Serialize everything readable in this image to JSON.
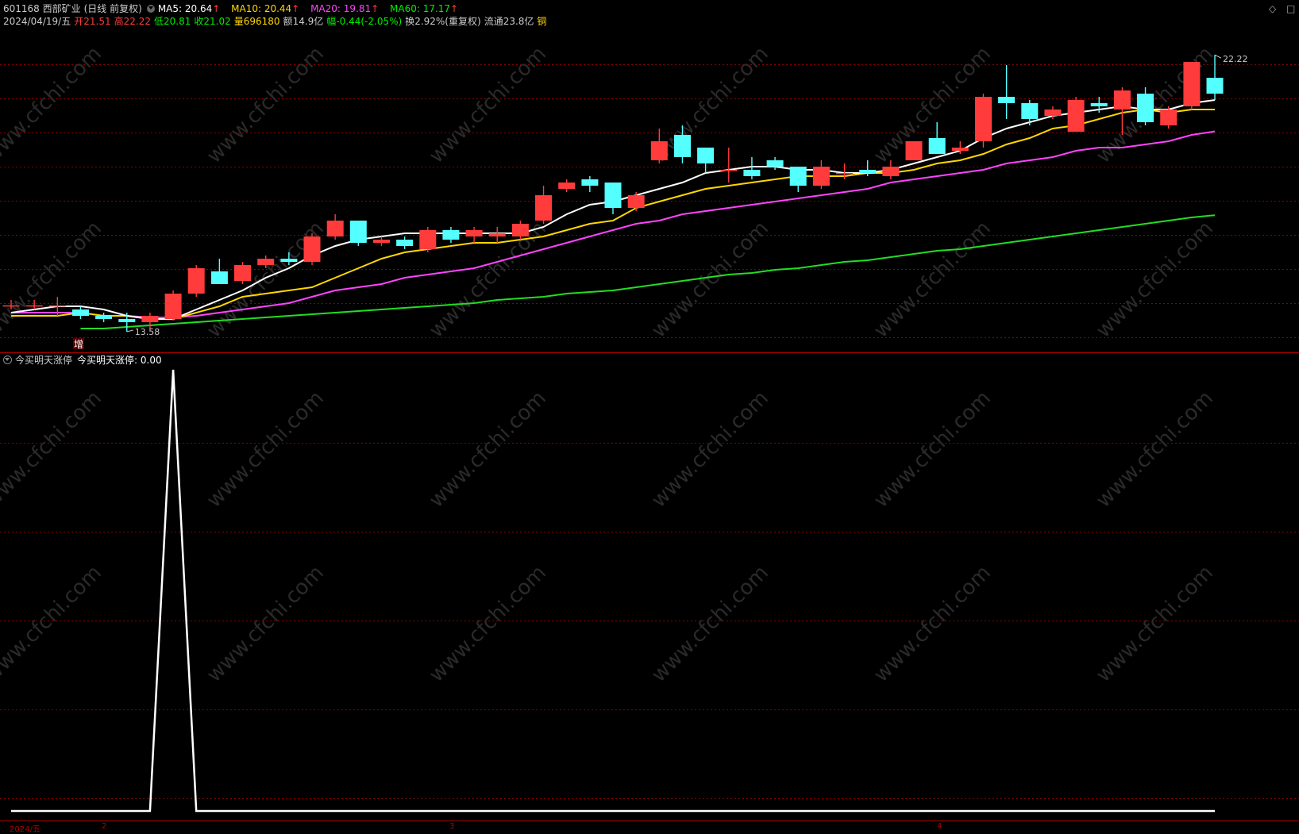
{
  "stock": {
    "code_name": "601168 西部矿业",
    "period": "(日线 前复权)",
    "date": "2024/04/19/五",
    "open_label": "开",
    "open": "21.51",
    "high_label": "高",
    "high": "22.22",
    "low_label": "低",
    "low": "20.81",
    "close_label": "收",
    "close": "21.02",
    "vol_label": "量",
    "vol": "696180",
    "amt_label": "额",
    "amt": "14.9亿",
    "chg_label": "幅",
    "chg": "-0.44(-2.05%)",
    "turnover": "换2.92%(重复权)",
    "float": "流通23.8亿",
    "sector": "铜"
  },
  "ma": [
    {
      "label": "MA5: 20.64",
      "arrow": "↑",
      "color": "#ffffff"
    },
    {
      "label": "MA10: 20.44",
      "arrow": "↑",
      "color": "#ffd700"
    },
    {
      "label": "MA20: 19.81",
      "arrow": "↑",
      "color": "#ff44ff"
    },
    {
      "label": "MA60: 17.17",
      "arrow": "↑",
      "color": "#00ee00"
    }
  ],
  "colors": {
    "up": "#ff3b3b",
    "down": "#54ffff",
    "ma5": "#ffffff",
    "ma10": "#ffd700",
    "ma20": "#ff44ff",
    "ma60": "#22dd22",
    "grid": "#8b0000",
    "indicator": "#ffffff"
  },
  "marks": {
    "high": "22.22",
    "low": "13.58",
    "badge": "增"
  },
  "indicator": {
    "name": "今买明天涨停",
    "value_label": "今买明天涨停: 0.00"
  },
  "watermark": "www.cfchi.com",
  "timeaxis": [
    "2024/五",
    "2",
    "3",
    "4"
  ],
  "controls": {
    "diamond": "◇",
    "close": "□"
  },
  "chart_data": {
    "type": "candlestick",
    "ylim": [
      13.0,
      23.0
    ],
    "candles": [
      {
        "o": 14.33,
        "h": 14.5,
        "l": 14.2,
        "c": 14.33
      },
      {
        "o": 14.33,
        "h": 14.5,
        "l": 14.2,
        "c": 14.33
      },
      {
        "o": 14.33,
        "h": 14.6,
        "l": 14.0,
        "c": 14.33
      },
      {
        "o": 14.2,
        "h": 14.3,
        "l": 13.9,
        "c": 14.0
      },
      {
        "o": 14.0,
        "h": 14.1,
        "l": 13.8,
        "c": 13.9
      },
      {
        "o": 13.9,
        "h": 14.1,
        "l": 13.5,
        "c": 13.8
      },
      {
        "o": 13.8,
        "h": 14.1,
        "l": 13.58,
        "c": 14.0
      },
      {
        "o": 13.9,
        "h": 14.8,
        "l": 13.85,
        "c": 14.7
      },
      {
        "o": 14.7,
        "h": 15.6,
        "l": 14.6,
        "c": 15.5
      },
      {
        "o": 15.4,
        "h": 15.8,
        "l": 15.0,
        "c": 15.0
      },
      {
        "o": 15.1,
        "h": 15.7,
        "l": 15.0,
        "c": 15.6
      },
      {
        "o": 15.6,
        "h": 15.9,
        "l": 15.5,
        "c": 15.8
      },
      {
        "o": 15.8,
        "h": 16.0,
        "l": 15.6,
        "c": 15.7
      },
      {
        "o": 15.7,
        "h": 16.6,
        "l": 15.6,
        "c": 16.5
      },
      {
        "o": 16.5,
        "h": 17.2,
        "l": 16.4,
        "c": 17.0
      },
      {
        "o": 17.0,
        "h": 17.0,
        "l": 16.2,
        "c": 16.3
      },
      {
        "o": 16.3,
        "h": 16.5,
        "l": 16.2,
        "c": 16.4
      },
      {
        "o": 16.4,
        "h": 16.5,
        "l": 16.1,
        "c": 16.2
      },
      {
        "o": 16.1,
        "h": 16.8,
        "l": 16.0,
        "c": 16.7
      },
      {
        "o": 16.7,
        "h": 16.8,
        "l": 16.3,
        "c": 16.4
      },
      {
        "o": 16.5,
        "h": 16.8,
        "l": 16.3,
        "c": 16.7
      },
      {
        "o": 16.5,
        "h": 16.8,
        "l": 16.3,
        "c": 16.6
      },
      {
        "o": 16.5,
        "h": 17.0,
        "l": 16.4,
        "c": 16.9
      },
      {
        "o": 17.0,
        "h": 18.1,
        "l": 16.9,
        "c": 17.8
      },
      {
        "o": 18.0,
        "h": 18.3,
        "l": 17.9,
        "c": 18.2
      },
      {
        "o": 18.3,
        "h": 18.4,
        "l": 17.9,
        "c": 18.1
      },
      {
        "o": 18.2,
        "h": 18.2,
        "l": 17.2,
        "c": 17.4
      },
      {
        "o": 17.4,
        "h": 17.9,
        "l": 17.3,
        "c": 17.8
      },
      {
        "o": 18.9,
        "h": 19.9,
        "l": 18.8,
        "c": 19.5
      },
      {
        "o": 19.7,
        "h": 20.0,
        "l": 18.8,
        "c": 19.0
      },
      {
        "o": 19.3,
        "h": 19.3,
        "l": 18.5,
        "c": 18.8
      },
      {
        "o": 18.6,
        "h": 19.3,
        "l": 18.2,
        "c": 18.6
      },
      {
        "o": 18.6,
        "h": 19.0,
        "l": 18.3,
        "c": 18.4
      },
      {
        "o": 18.9,
        "h": 19.0,
        "l": 18.6,
        "c": 18.7
      },
      {
        "o": 18.7,
        "h": 18.7,
        "l": 17.9,
        "c": 18.1
      },
      {
        "o": 18.1,
        "h": 18.9,
        "l": 18.0,
        "c": 18.7
      },
      {
        "o": 18.5,
        "h": 18.8,
        "l": 18.3,
        "c": 18.5
      },
      {
        "o": 18.6,
        "h": 18.9,
        "l": 18.4,
        "c": 18.5
      },
      {
        "o": 18.4,
        "h": 18.9,
        "l": 18.3,
        "c": 18.7
      },
      {
        "o": 18.9,
        "h": 19.5,
        "l": 18.9,
        "c": 19.5
      },
      {
        "o": 19.6,
        "h": 20.1,
        "l": 19.1,
        "c": 19.1
      },
      {
        "o": 19.2,
        "h": 19.5,
        "l": 19.1,
        "c": 19.3
      },
      {
        "o": 19.5,
        "h": 21.0,
        "l": 19.3,
        "c": 20.9
      },
      {
        "o": 20.9,
        "h": 21.9,
        "l": 20.2,
        "c": 20.7
      },
      {
        "o": 20.7,
        "h": 20.8,
        "l": 20.0,
        "c": 20.2
      },
      {
        "o": 20.3,
        "h": 20.6,
        "l": 20.2,
        "c": 20.5
      },
      {
        "o": 19.8,
        "h": 20.9,
        "l": 19.8,
        "c": 20.8
      },
      {
        "o": 20.7,
        "h": 20.9,
        "l": 20.4,
        "c": 20.6
      },
      {
        "o": 20.5,
        "h": 21.2,
        "l": 19.7,
        "c": 21.1
      },
      {
        "o": 21.0,
        "h": 21.2,
        "l": 20.0,
        "c": 20.1
      },
      {
        "o": 20.0,
        "h": 20.6,
        "l": 19.9,
        "c": 20.5
      },
      {
        "o": 20.6,
        "h": 22.0,
        "l": 20.5,
        "c": 22.0
      },
      {
        "o": 21.5,
        "h": 22.22,
        "l": 20.8,
        "c": 21.0
      }
    ],
    "ma5": [
      14.1,
      14.2,
      14.3,
      14.3,
      14.2,
      14.0,
      13.9,
      13.9,
      14.2,
      14.5,
      14.8,
      15.2,
      15.5,
      15.9,
      16.2,
      16.4,
      16.5,
      16.6,
      16.6,
      16.6,
      16.6,
      16.6,
      16.6,
      16.8,
      17.2,
      17.5,
      17.6,
      17.8,
      18.0,
      18.2,
      18.5,
      18.6,
      18.7,
      18.7,
      18.6,
      18.6,
      18.5,
      18.5,
      18.6,
      18.8,
      19.0,
      19.2,
      19.6,
      19.9,
      20.1,
      20.3,
      20.4,
      20.5,
      20.6,
      20.5,
      20.5,
      20.7,
      20.8
    ],
    "ma10": [
      14.0,
      14.0,
      14.0,
      14.1,
      14.0,
      14.0,
      13.9,
      13.9,
      14.1,
      14.3,
      14.6,
      14.7,
      14.8,
      14.9,
      15.2,
      15.5,
      15.8,
      16.0,
      16.1,
      16.2,
      16.3,
      16.3,
      16.4,
      16.5,
      16.7,
      16.9,
      17.0,
      17.4,
      17.6,
      17.8,
      18.0,
      18.1,
      18.2,
      18.3,
      18.4,
      18.4,
      18.4,
      18.5,
      18.5,
      18.6,
      18.8,
      18.9,
      19.1,
      19.4,
      19.6,
      19.9,
      20.0,
      20.2,
      20.4,
      20.5,
      20.4,
      20.5,
      20.5
    ],
    "ma20": [
      14.1,
      14.1,
      14.1,
      14.1,
      14.0,
      14.0,
      13.95,
      13.95,
      14.0,
      14.1,
      14.2,
      14.3,
      14.4,
      14.6,
      14.8,
      14.9,
      15.0,
      15.2,
      15.3,
      15.4,
      15.5,
      15.7,
      15.9,
      16.1,
      16.3,
      16.5,
      16.7,
      16.9,
      17.0,
      17.2,
      17.3,
      17.4,
      17.5,
      17.6,
      17.7,
      17.8,
      17.9,
      18.0,
      18.2,
      18.3,
      18.4,
      18.5,
      18.6,
      18.8,
      18.9,
      19.0,
      19.2,
      19.3,
      19.3,
      19.4,
      19.5,
      19.7,
      19.81
    ],
    "ma60": [
      null,
      null,
      null,
      13.6,
      13.6,
      13.65,
      13.7,
      13.75,
      13.8,
      13.85,
      13.9,
      13.95,
      14.0,
      14.05,
      14.1,
      14.15,
      14.2,
      14.25,
      14.3,
      14.35,
      14.4,
      14.5,
      14.55,
      14.6,
      14.7,
      14.75,
      14.8,
      14.9,
      15.0,
      15.1,
      15.2,
      15.3,
      15.35,
      15.45,
      15.5,
      15.6,
      15.7,
      15.75,
      15.85,
      15.95,
      16.05,
      16.1,
      16.2,
      16.3,
      16.4,
      16.5,
      16.6,
      16.7,
      16.8,
      16.9,
      17.0,
      17.1,
      17.17
    ],
    "indicator_values": [
      0,
      0,
      0,
      0,
      0,
      0,
      0,
      1,
      0,
      0,
      0,
      0,
      0,
      0,
      0,
      0,
      0,
      0,
      0,
      0,
      0,
      0,
      0,
      0,
      0,
      0,
      0,
      0,
      0,
      0,
      0,
      0,
      0,
      0,
      0,
      0,
      0,
      0,
      0,
      0,
      0,
      0,
      0,
      0,
      0,
      0,
      0,
      0,
      0,
      0,
      0,
      0,
      0
    ]
  }
}
